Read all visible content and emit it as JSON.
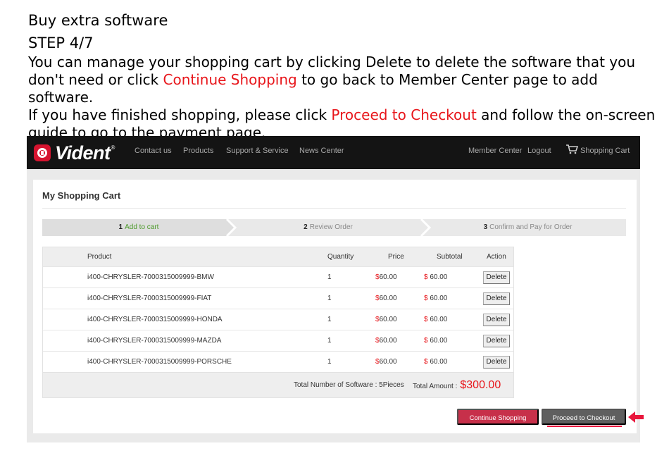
{
  "instructions": {
    "heading": "Buy extra software",
    "step": "STEP 4/7",
    "line1_a": "You can manage your shopping cart by clicking Delete to delete the software that you don't need or click ",
    "line1_hl": "Continue Shopping",
    "line1_b": " to go back to Member Center page to add software.",
    "line2_a": "If you have finished shopping, please click ",
    "line2_hl": "Proceed to Checkout",
    "line2_b": " and follow the on-screen guide to go to the payment page."
  },
  "navbar": {
    "brand": "Vident",
    "reg_mark": "®",
    "links": [
      "Contact us",
      "Products",
      "Support & Service",
      "News Center"
    ],
    "member_center": "Member Center",
    "logout": "Logout",
    "shopping_cart": "Shopping Cart"
  },
  "cart_page": {
    "title": "My Shopping Cart",
    "steps": [
      {
        "num": "1",
        "label": "Add to cart"
      },
      {
        "num": "2",
        "label": "Review Order"
      },
      {
        "num": "3",
        "label": "Confirm and Pay for Order"
      }
    ],
    "columns": {
      "product": "Product",
      "quantity": "Quantity",
      "price": "Price",
      "subtotal": "Subtotal",
      "action": "Action"
    },
    "rows": [
      {
        "product": "i400-CHRYSLER-7000315009999-BMW",
        "quantity": "1",
        "price": "60.00",
        "subtotal": " 60.00",
        "action": "Delete"
      },
      {
        "product": "i400-CHRYSLER-7000315009999-FIAT",
        "quantity": "1",
        "price": "60.00",
        "subtotal": " 60.00",
        "action": "Delete"
      },
      {
        "product": "i400-CHRYSLER-7000315009999-HONDA",
        "quantity": "1",
        "price": "60.00",
        "subtotal": " 60.00",
        "action": "Delete"
      },
      {
        "product": "i400-CHRYSLER-7000315009999-MAZDA",
        "quantity": "1",
        "price": "60.00",
        "subtotal": " 60.00",
        "action": "Delete"
      },
      {
        "product": "i400-CHRYSLER-7000315009999-PORSCHE",
        "quantity": "1",
        "price": "60.00",
        "subtotal": " 60.00",
        "action": "Delete"
      }
    ],
    "currency_symbol": "$",
    "total_software_label": "Total Number of Software : 5Pieces",
    "total_amount_label": "Total Amount :",
    "total_amount": "$300.00",
    "continue_button": "Continue Shopping",
    "checkout_button": "Proceed to Checkout"
  },
  "colors": {
    "highlight": "#e8161b",
    "navbar_bg": "#141414",
    "logo_red": "#d6142f",
    "step_active_text": "#4c9a2a",
    "continue_button": "#c7304a",
    "checkout_button": "#5f5f5f"
  },
  "icons": {
    "logo": "vident-logo-icon",
    "cart": "shopping-cart-icon",
    "pointer": "arrow-left-icon"
  }
}
